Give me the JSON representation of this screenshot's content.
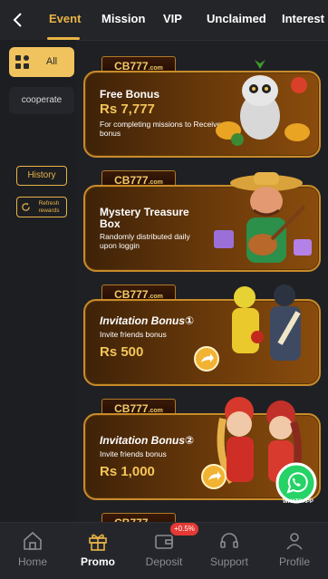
{
  "header": {
    "tabs": [
      {
        "label": "Event",
        "active": true
      },
      {
        "label": "Mission",
        "active": false
      },
      {
        "label": "VIP",
        "active": false
      },
      {
        "label": "Unclaimed",
        "active": false
      },
      {
        "label": "Interest",
        "active": false
      }
    ]
  },
  "sidebar": {
    "categories": [
      {
        "label": "All",
        "active": true
      },
      {
        "label": "cooperate",
        "active": false
      }
    ],
    "history_label": "History",
    "refresh_label": "Refresh rewards"
  },
  "brand": {
    "name": "CB777",
    "domain": ".com"
  },
  "promos": [
    {
      "title": "Free Bonus",
      "amount": "Rs 7,777",
      "description": "For completing missions to Receive bonus"
    },
    {
      "title": "Mystery Treasure Box",
      "description": "Randomly distributed daily upon loggin"
    },
    {
      "title": "Invitation Bonus①",
      "description": "Invite friends bonus",
      "amount": "Rs 500"
    },
    {
      "title": "Invitation Bonus②",
      "description": "Invite friends bonus",
      "amount": "Rs 1,000"
    }
  ],
  "floating": {
    "whatsapp_label": "WHATSAPP"
  },
  "bottom_nav": {
    "items": [
      {
        "label": "Home",
        "icon": "home-icon",
        "active": false
      },
      {
        "label": "Promo",
        "icon": "gift-icon",
        "active": true
      },
      {
        "label": "Deposit",
        "icon": "wallet-icon",
        "active": false
      },
      {
        "label": "Support",
        "icon": "headset-icon",
        "active": false
      },
      {
        "label": "Profile",
        "icon": "user-icon",
        "active": false
      }
    ],
    "deposit_badge": "+0.5%"
  },
  "colors": {
    "accent": "#e8b446",
    "background": "#1f2024",
    "card_border": "#c98b2a",
    "badge": "#e53935"
  }
}
